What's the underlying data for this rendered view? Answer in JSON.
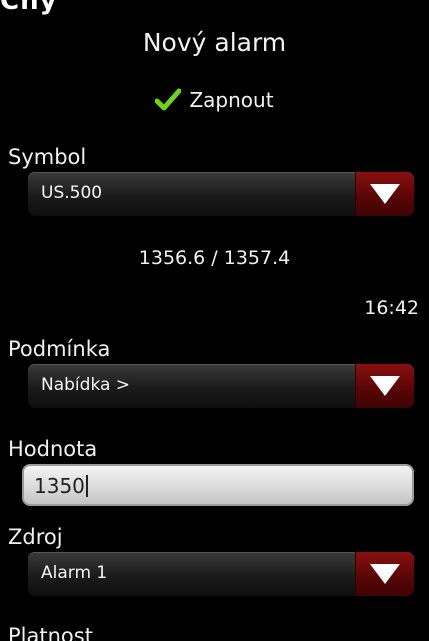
{
  "header": {
    "clipped_text": "Cny",
    "title": "Nový alarm"
  },
  "enable": {
    "label": "Zapnout",
    "checked": true,
    "check_color": "#6fd21c"
  },
  "symbol": {
    "label": "Symbol",
    "value": "US.500"
  },
  "quote": {
    "prices": "1356.6 / 1357.4",
    "time": "16:42"
  },
  "condition": {
    "label": "Podmínka",
    "value": "Nabídka >"
  },
  "value_field": {
    "label": "Hodnota",
    "value": "1350"
  },
  "source": {
    "label": "Zdroj",
    "value": "Alarm 1"
  },
  "validity": {
    "label": "Platnost"
  },
  "colors": {
    "background": "#000000",
    "dropdown_accent": "#7a0c0c",
    "arrow": "#ffffff"
  }
}
